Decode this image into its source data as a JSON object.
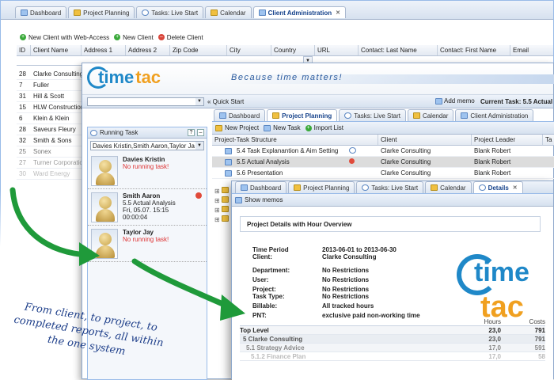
{
  "back_window": {
    "tabs": [
      {
        "label": "Dashboard",
        "icon": "grid-icon"
      },
      {
        "label": "Project Planning",
        "icon": "folder-icon"
      },
      {
        "label": "Tasks: Live Start",
        "icon": "play-icon"
      },
      {
        "label": "Calendar",
        "icon": "calendar-icon"
      },
      {
        "label": "Client Administration",
        "icon": "client-icon",
        "active": true,
        "close": "✕"
      }
    ],
    "toolbar": {
      "new_web": "New Client with Web-Access",
      "new_client": "New Client",
      "delete_client": "Delete Client"
    },
    "columns": [
      "ID",
      "Client Name",
      "Address 1",
      "Address 2",
      "Zip Code",
      "City",
      "Country",
      "URL",
      "Contact: Last Name",
      "Contact: First Name",
      "Email"
    ],
    "rows": [
      {
        "id": "28",
        "name": "Clarke Consulting"
      },
      {
        "id": "7",
        "name": "Fuller"
      },
      {
        "id": "31",
        "name": "Hill & Scott"
      },
      {
        "id": "15",
        "name": "HLW Construction"
      },
      {
        "id": "6",
        "name": "Klein & Klein"
      },
      {
        "id": "28",
        "name": "Saveurs Fleury"
      },
      {
        "id": "32",
        "name": "Smith & Sons"
      },
      {
        "id": "25",
        "name": "Sonex"
      },
      {
        "id": "27",
        "name": "Turner Corporation"
      },
      {
        "id": "30",
        "name": "Ward Energy"
      }
    ]
  },
  "mid_window": {
    "logo_time": "time",
    "logo_tac": "tac",
    "slogan": "Because time matters!",
    "quick_start": "« Quick Start",
    "add_memo": "Add memo",
    "current_task": "Current Task: 5.5 Actual A",
    "tabs": [
      {
        "label": "Dashboard"
      },
      {
        "label": "Project Planning",
        "active": true
      },
      {
        "label": "Tasks: Live Start"
      },
      {
        "label": "Calendar"
      },
      {
        "label": "Client Administration"
      }
    ],
    "toolbar": {
      "new_project": "New Project",
      "new_task": "New Task",
      "import_list": "Import List"
    },
    "columns": [
      "Project-Task Structure",
      "Client",
      "Project Leader",
      "Ta"
    ],
    "rows": [
      {
        "task": "5.4 Task Explanantion & Aim Setting",
        "client": "Clarke Consulting",
        "leader": "Blank Robert"
      },
      {
        "task": "5.5 Actual Analysis",
        "client": "Clarke Consulting",
        "leader": "Blank Robert",
        "selected": true
      },
      {
        "task": "5.6 Presentation",
        "client": "Clarke Consulting",
        "leader": "Blank Robert"
      }
    ],
    "running_task": {
      "title": "Running Task",
      "filter": "Davies Kristin,Smith Aaron,Taylor Ja",
      "people": [
        {
          "name": "Davies Kristin",
          "status": "No running task!"
        },
        {
          "name": "Smith Aaron",
          "task": "5.5 Actual Analysis",
          "date": "Fri, 05.07. 15:15",
          "time": "00:00:04"
        },
        {
          "name": "Taylor Jay",
          "status": "No running task!"
        }
      ]
    }
  },
  "front_window": {
    "tabs": [
      {
        "label": "Dashboard"
      },
      {
        "label": "Project Planning"
      },
      {
        "label": "Tasks: Live Start"
      },
      {
        "label": "Calendar"
      },
      {
        "label": "Details",
        "active": true,
        "close": "✕"
      }
    ],
    "show_memos": "Show memos",
    "report_title": "Project Details with Hour Overview",
    "details": [
      {
        "k": "Time Period",
        "v": "2013-06-01 to 2013-06-30"
      },
      {
        "k": "Client:",
        "v": "Clarke Consulting"
      },
      {
        "k": "Department:",
        "v": "No Restrictions"
      },
      {
        "k": "User:",
        "v": "No Restrictions"
      },
      {
        "k": "Project:",
        "v": "No Restrictions"
      },
      {
        "k": "Task Type:",
        "v": "No Restrictions"
      },
      {
        "k": "Billable:",
        "v": "All tracked hours"
      },
      {
        "k": "PNT:",
        "v": "exclusive paid non-working time"
      }
    ],
    "summary_headers": {
      "hours": "Hours",
      "costs": "Costs"
    },
    "summary": [
      {
        "label": "Top Level",
        "hours": "23,0",
        "costs": "791"
      },
      {
        "label": "5 Clarke Consulting",
        "hours": "23,0",
        "costs": "791"
      },
      {
        "label": "5.1 Strategy Advice",
        "hours": "17,0",
        "costs": "591"
      },
      {
        "label": "5.1.2 Finance Plan",
        "hours": "17,0",
        "costs": "58"
      }
    ]
  },
  "caption": "From client, to project, to completed reports, all within the one system",
  "colors": {
    "accent": "#15428b",
    "logo_blue": "#1f88c8",
    "logo_orange": "#f0a020",
    "arrow": "#1f9a3a"
  }
}
